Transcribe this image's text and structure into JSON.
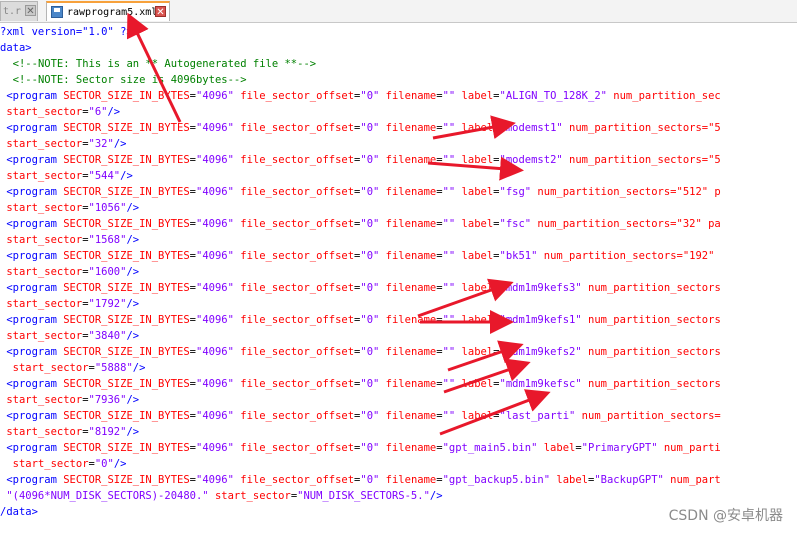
{
  "tabs": [
    {
      "label": "t.r",
      "active": false
    },
    {
      "label": "rawprogram5.xml",
      "active": true
    }
  ],
  "xml": {
    "decl": "?xml version=\"1.0\" ?>",
    "open_root": "data>",
    "comment1": "<!--NOTE: This is an ** Autogenerated file **-->",
    "comment2": "<!--NOTE: Sector size is 4096bytes-->",
    "programs": [
      {
        "filename": "",
        "label": "ALIGN_TO_128K_2",
        "rest": " num_partition_sec",
        "start_sector": "6"
      },
      {
        "filename": "",
        "label": "modemst1",
        "rest": " num_partition_sectors=\"5",
        "start_sector": "32"
      },
      {
        "filename": "",
        "label": "modemst2",
        "rest": " num_partition_sectors=\"5",
        "start_sector": "544"
      },
      {
        "filename": "",
        "label": "fsg",
        "rest": " num_partition_sectors=\"512\" p",
        "start_sector": "1056"
      },
      {
        "filename": "",
        "label": "fsc",
        "rest": " num_partition_sectors=\"32\" pa",
        "start_sector": "1568"
      },
      {
        "filename": "",
        "label": "bk51",
        "rest": " num_partition_sectors=\"192\" ",
        "start_sector": "1600"
      },
      {
        "filename": "",
        "label": "mdm1m9kefs3",
        "rest": " num_partition_sectors",
        "start_sector": "1792"
      },
      {
        "filename": "",
        "label": "mdm1m9kefs1",
        "rest": " num_partition_sectors",
        "start_sector": "3840"
      },
      {
        "filename": "",
        "label": "mdm1m9kefs2",
        "rest": " num_partition_sectors",
        "start_sector": "5888",
        "indent": true
      },
      {
        "filename": "",
        "label": "mdm1m9kefsc",
        "rest": " num_partition_sectors",
        "start_sector": "7936"
      },
      {
        "filename": "",
        "label": "last_parti",
        "rest": " num_partition_sectors=",
        "start_sector": "8192"
      },
      {
        "filename": "gpt_main5.bin",
        "label": "PrimaryGPT",
        "rest": " num_parti",
        "start_sector": "0",
        "indent": true
      },
      {
        "filename": "gpt_backup5.bin",
        "label": "BackupGPT",
        "rest": " num_part",
        "start_sector": "NUM_DISK_SECTORS-5.",
        "pre_start": "\"(4096*NUM_DISK_SECTORS)-20480.\""
      }
    ],
    "close_root": "/data>"
  },
  "watermark": "CSDN @安卓机器",
  "colors": {
    "tag": "#0000ff",
    "attr": "#ff0000",
    "value": "#8000ff",
    "comment": "#008000",
    "arrow": "#e8182b"
  }
}
